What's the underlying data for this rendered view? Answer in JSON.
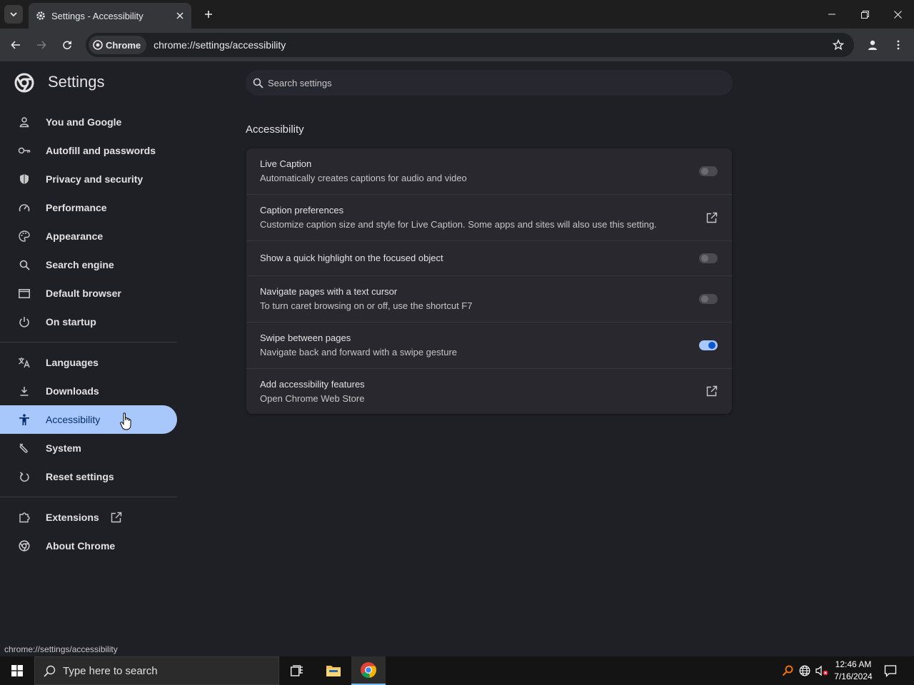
{
  "browser": {
    "tab_title": "Settings - Accessibility",
    "chip_label": "Chrome",
    "url": "chrome://settings/accessibility",
    "status_url": "chrome://settings/accessibility"
  },
  "header": {
    "title": "Settings",
    "search_placeholder": "Search settings"
  },
  "sidebar": {
    "items": [
      {
        "label": "You and Google",
        "icon": "person-icon"
      },
      {
        "label": "Autofill and passwords",
        "icon": "key-icon"
      },
      {
        "label": "Privacy and security",
        "icon": "shield-icon"
      },
      {
        "label": "Performance",
        "icon": "speedometer-icon"
      },
      {
        "label": "Appearance",
        "icon": "palette-icon"
      },
      {
        "label": "Search engine",
        "icon": "search-icon"
      },
      {
        "label": "Default browser",
        "icon": "browser-window-icon"
      },
      {
        "label": "On startup",
        "icon": "power-icon"
      },
      {
        "label": "Languages",
        "icon": "translate-icon"
      },
      {
        "label": "Downloads",
        "icon": "download-icon"
      },
      {
        "label": "Accessibility",
        "icon": "accessibility-icon",
        "active": true
      },
      {
        "label": "System",
        "icon": "wrench-icon"
      },
      {
        "label": "Reset settings",
        "icon": "reset-icon"
      },
      {
        "label": "Extensions",
        "icon": "puzzle-icon"
      },
      {
        "label": "About Chrome",
        "icon": "chrome-icon"
      }
    ]
  },
  "main": {
    "section_title": "Accessibility",
    "rows": [
      {
        "title": "Live Caption",
        "subtitle": "Automatically creates captions for audio and video",
        "control": "toggle",
        "on": false
      },
      {
        "title": "Caption preferences",
        "subtitle": "Customize caption size and style for Live Caption. Some apps and sites will also use this setting.",
        "control": "external-link"
      },
      {
        "title": "Show a quick highlight on the focused object",
        "subtitle": "",
        "control": "toggle",
        "on": false
      },
      {
        "title": "Navigate pages with a text cursor",
        "subtitle": "To turn caret browsing on or off, use the shortcut F7",
        "control": "toggle",
        "on": false
      },
      {
        "title": "Swipe between pages",
        "subtitle": "Navigate back and forward with a swipe gesture",
        "control": "toggle",
        "on": true
      },
      {
        "title": "Add accessibility features",
        "subtitle": "Open Chrome Web Store",
        "control": "external-link"
      }
    ]
  },
  "taskbar": {
    "search_placeholder": "Type here to search",
    "time": "12:46 AM",
    "date": "7/16/2024"
  },
  "colors": {
    "accent": "#a8c7fa",
    "toggle_on_knob": "#0b57d0",
    "background": "#1f1f26",
    "card": "#28282e"
  }
}
